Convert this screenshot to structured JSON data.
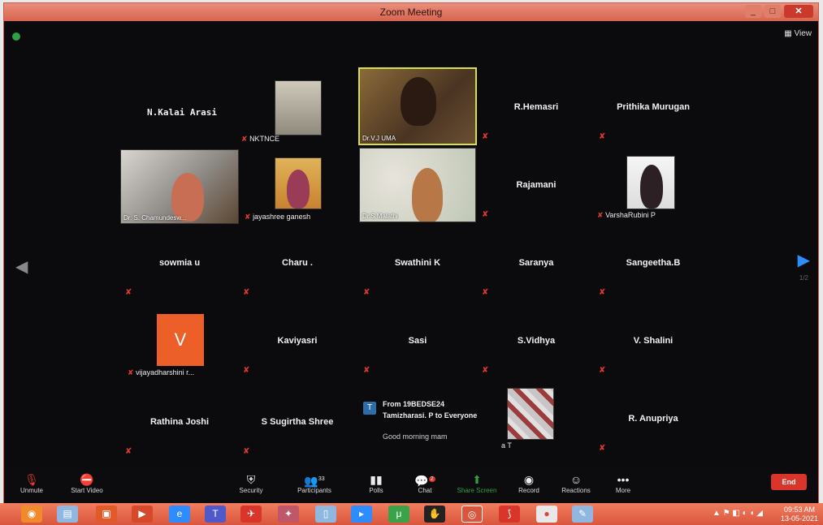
{
  "window": {
    "title": "Zoom Meeting",
    "controls": [
      "_",
      "□",
      "✕"
    ]
  },
  "view_label": "View",
  "participants": [
    {
      "name": "N.Kalai Arasi",
      "type": "name"
    },
    {
      "name": "NKTNCE",
      "type": "video"
    },
    {
      "name": "Dr.V.J UMA",
      "type": "video"
    },
    {
      "name": "R.Hemasri",
      "type": "name"
    },
    {
      "name": "Prithika Murugan",
      "type": "name"
    },
    {
      "name": "Dr. S. Chamundesw...",
      "type": "video"
    },
    {
      "name": "jayashree ganesh",
      "type": "video"
    },
    {
      "name": "Dr.S.Malathi",
      "type": "video"
    },
    {
      "name": "Rajamani",
      "type": "name"
    },
    {
      "name": "VarshaRubini P",
      "type": "video"
    },
    {
      "name": "sowmia u",
      "type": "name"
    },
    {
      "name": "Charu .",
      "type": "name"
    },
    {
      "name": "Swathini K",
      "type": "name"
    },
    {
      "name": "Saranya",
      "type": "name"
    },
    {
      "name": "Sangeetha.B",
      "type": "name"
    },
    {
      "name": "vijayadharshini r...",
      "type": "avatar",
      "initial": "V"
    },
    {
      "name": "Kaviyasri",
      "type": "name"
    },
    {
      "name": "Sasi",
      "type": "name"
    },
    {
      "name": "S.Vidhya",
      "type": "name"
    },
    {
      "name": "V. Shalini",
      "type": "name"
    },
    {
      "name": "Rathina Joshi",
      "type": "name"
    },
    {
      "name": "S Sugirtha Shree",
      "type": "name"
    },
    {
      "name": "R. Anupriya",
      "type": "name"
    },
    {
      "name": "a T",
      "type": "video"
    }
  ],
  "page_indicator": "1/2",
  "chat_notification": {
    "avatar_initial": "T",
    "from_line": "From 19BEDSE24",
    "to_line": "Tamizharasi. P to Everyone",
    "message": "Good morning mam"
  },
  "toolbar": {
    "unmute": "Unmute",
    "start_video": "Start Video",
    "security": "Security",
    "participants": "Participants",
    "participants_count": "33",
    "polls": "Polls",
    "chat": "Chat",
    "chat_badge": "2",
    "share_screen": "Share Screen",
    "record": "Record",
    "reactions": "Reactions",
    "more": "More",
    "end": "End"
  },
  "taskbar": {
    "time": "09:53 AM",
    "date": "13-05-2021"
  },
  "colors": {
    "accent_blue": "#2d8cff",
    "end_red": "#d9352a",
    "avatar_orange": "#ec5f29",
    "taskbar": "#e3664a"
  }
}
